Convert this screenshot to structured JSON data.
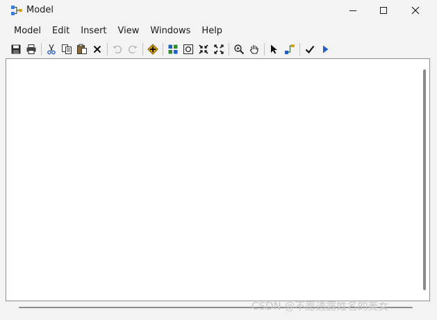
{
  "window": {
    "title": "Model"
  },
  "menu": {
    "items": [
      {
        "label": "Model"
      },
      {
        "label": "Edit"
      },
      {
        "label": "Insert"
      },
      {
        "label": "View"
      },
      {
        "label": "Windows"
      },
      {
        "label": "Help"
      }
    ]
  },
  "toolbar": {
    "buttons": [
      {
        "icon": "save-icon"
      },
      {
        "icon": "print-icon"
      },
      {
        "icon": "cut-icon"
      },
      {
        "icon": "copy-icon"
      },
      {
        "icon": "paste-icon"
      },
      {
        "icon": "delete-icon"
      },
      {
        "icon": "undo-icon",
        "enabled": false
      },
      {
        "icon": "redo-icon",
        "enabled": false
      },
      {
        "icon": "add-icon"
      },
      {
        "icon": "grid-icon"
      },
      {
        "icon": "fit-icon"
      },
      {
        "icon": "collapse-icon"
      },
      {
        "icon": "expand-icon"
      },
      {
        "icon": "zoom-icon"
      },
      {
        "icon": "pan-hand-icon"
      },
      {
        "icon": "pointer-icon"
      },
      {
        "icon": "connector-icon"
      },
      {
        "icon": "check-icon"
      },
      {
        "icon": "run-icon"
      }
    ]
  },
  "colors": {
    "accent_blue": "#1f5fbf",
    "accent_green": "#2e8b2e",
    "accent_gold": "#d9a400"
  },
  "watermark": {
    "text": "CSDN @不愿透露姓名的美女"
  }
}
